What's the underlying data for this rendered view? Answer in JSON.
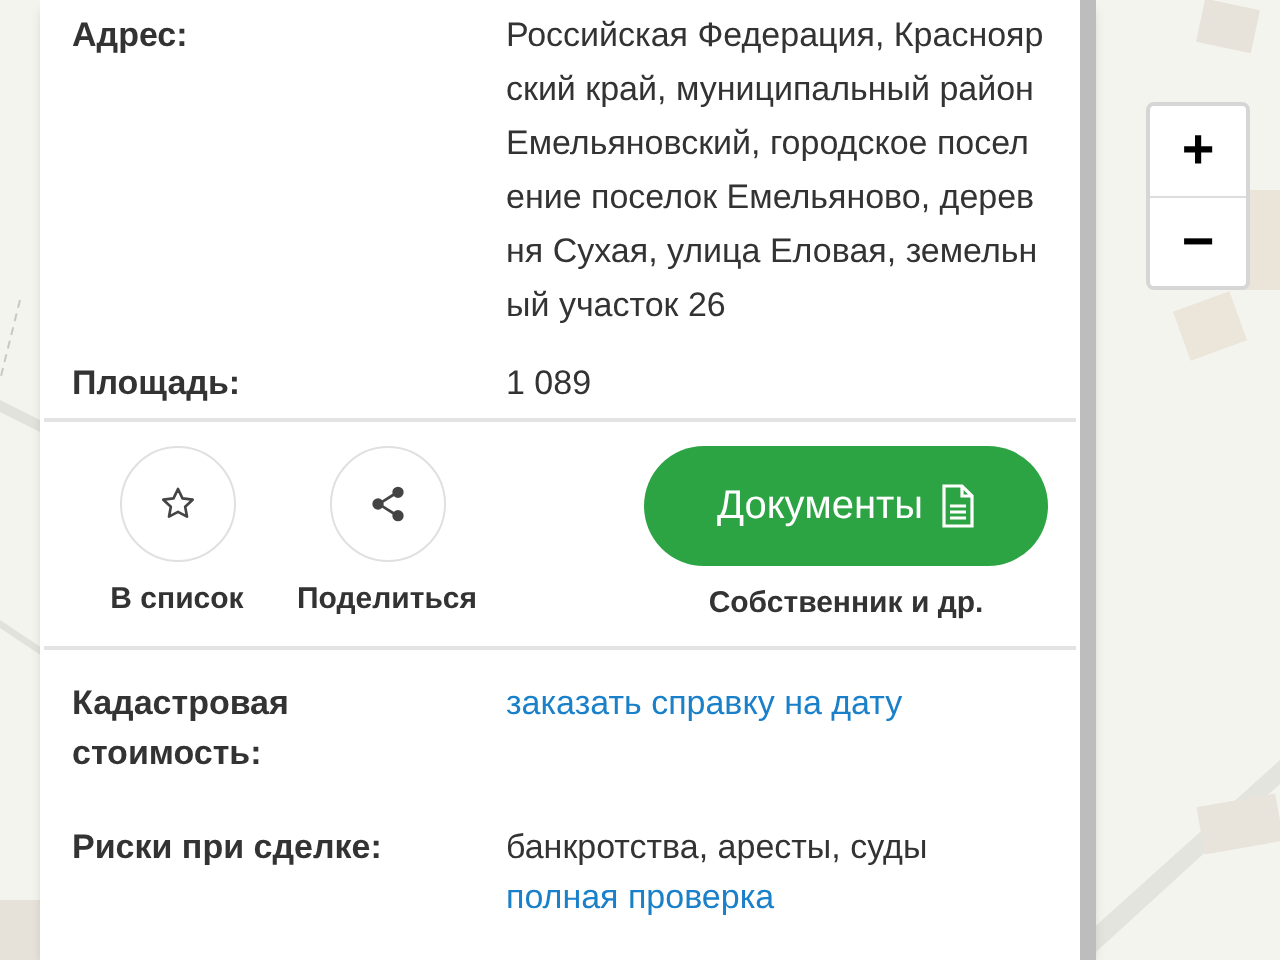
{
  "fields": [
    {
      "label": "Адрес:",
      "value": "Российская Федерация, Красноярский край, муниципальный район Емельяновский, городское поселение поселок Емельяново, деревня Сухая, улица Еловая, земельный участок 26"
    },
    {
      "label": "Площадь:",
      "value": "1 089"
    }
  ],
  "actions": [
    {
      "label": "В список",
      "kind": "star"
    },
    {
      "label": "Поделиться",
      "kind": "share"
    }
  ],
  "documents_button": {
    "label": "Документы",
    "caption": "Собственник и др."
  },
  "details": [
    {
      "label": "Кадастровая стоимость:",
      "parts": [
        {
          "kind": "link",
          "text": "заказать справку на дату"
        }
      ]
    },
    {
      "label": "Риски при сделке:",
      "parts": [
        {
          "kind": "text",
          "text": "банкротства, аресты, суды"
        },
        {
          "kind": "link",
          "text": "полная проверка"
        }
      ]
    }
  ],
  "map": {
    "kind": "picture",
    "zoom_controls": [
      "+",
      "−"
    ]
  }
}
